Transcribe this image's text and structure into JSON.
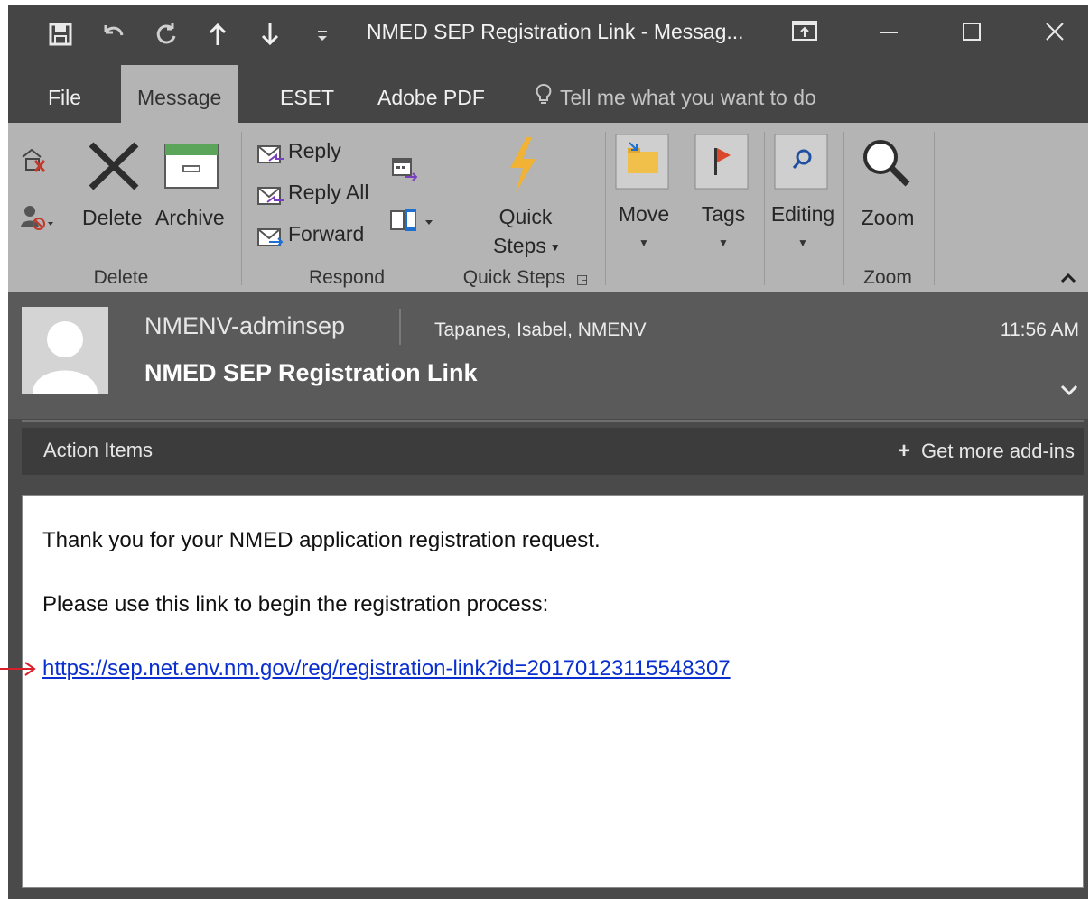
{
  "window": {
    "title": "NMED SEP Registration Link - Messag..."
  },
  "qat": {
    "icons": [
      "save-icon",
      "undo-icon",
      "redo-icon",
      "up-arrow-icon",
      "down-arrow-icon",
      "customize-icon"
    ]
  },
  "tabs": [
    {
      "label": "File"
    },
    {
      "label": "Message"
    },
    {
      "label": "ESET"
    },
    {
      "label": "Adobe PDF"
    }
  ],
  "tellme": "Tell me what you want to do",
  "ribbon": {
    "delete_group": {
      "label": "Delete",
      "delete": "Delete",
      "archive": "Archive"
    },
    "respond_group": {
      "label": "Respond",
      "reply": "Reply",
      "reply_all": "Reply All",
      "forward": "Forward"
    },
    "quick_steps_group": {
      "label": "Quick Steps",
      "button": "Quick\nSteps",
      "button_line1": "Quick",
      "button_line2": "Steps"
    },
    "move": "Move",
    "tags": "Tags",
    "editing": "Editing",
    "zoom_group": {
      "label": "Zoom",
      "button": "Zoom"
    }
  },
  "message": {
    "sender": "NMENV-adminsep",
    "to": "Tapanes, Isabel, NMENV",
    "time": "11:56 AM",
    "subject": "NMED SEP Registration Link"
  },
  "action_items": {
    "title": "Action Items",
    "addins": "Get more add-ins"
  },
  "body": {
    "line1": "Thank you for your NMED application registration request.",
    "line2": "Please use this link to begin the registration process:",
    "link": "https://sep.net.env.nm.gov/reg/registration-link?id=20170123115548307"
  },
  "colors": {
    "link": "#0a2fd0",
    "annotation_arrow": "#d9202a",
    "ribbon": "#b4b4b4"
  }
}
